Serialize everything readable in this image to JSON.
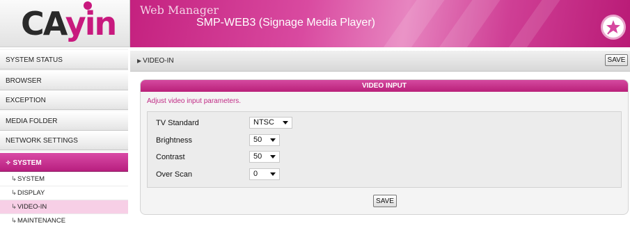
{
  "logo": {
    "part1": "CA",
    "part2": "yin"
  },
  "header": {
    "title": "Web Manager",
    "subtitle": "SMP-WEB3 (Signage Media Player)",
    "badge_icon": "star-wand-icon"
  },
  "sidebar": {
    "items": [
      {
        "label": "SYSTEM STATUS"
      },
      {
        "label": "BROWSER"
      },
      {
        "label": "EXCEPTION"
      },
      {
        "label": "MEDIA FOLDER"
      },
      {
        "label": "NETWORK SETTINGS"
      },
      {
        "label": "SYSTEM"
      }
    ],
    "active_icon": "star-icon",
    "subitems": [
      {
        "label": "SYSTEM"
      },
      {
        "label": "DISPLAY"
      },
      {
        "label": "VIDEO-IN"
      },
      {
        "label": "MAINTENANCE"
      }
    ],
    "active_subitem": "VIDEO-IN"
  },
  "breadcrumb": {
    "label": "VIDEO-IN",
    "save_label": "SAVE"
  },
  "panel": {
    "title": "VIDEO INPUT",
    "description": "Adjust video input parameters.",
    "fields": [
      {
        "label": "TV Standard",
        "value": "NTSC"
      },
      {
        "label": "Brightness",
        "value": "50"
      },
      {
        "label": "Contrast",
        "value": "50"
      },
      {
        "label": "Over Scan",
        "value": "0"
      }
    ],
    "save_label": "SAVE"
  },
  "colors": {
    "accent": "#c8197e",
    "panel_head": "#c8307f",
    "active_sub": "#f7cfe6"
  }
}
